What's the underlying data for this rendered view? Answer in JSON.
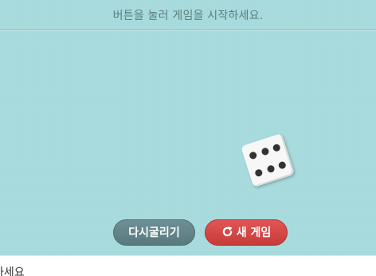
{
  "status": {
    "message": "버튼을 눌러 게임을 시작하세요."
  },
  "die": {
    "face_value": 6
  },
  "controls": {
    "reroll_label": "다시굴리기",
    "new_game_label": "새 게임",
    "new_game_icon": "refresh-icon"
  },
  "footer": {
    "text": "하세요"
  },
  "colors": {
    "background": "#a6dadc",
    "reroll_button": "#5f8186",
    "new_game_button": "#d44848",
    "pip": "#333333"
  }
}
